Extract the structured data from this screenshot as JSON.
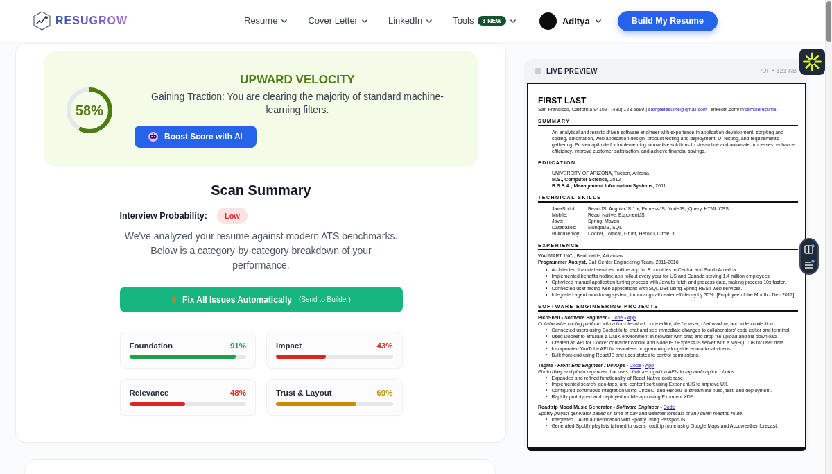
{
  "header": {
    "brand": "RESUGROW",
    "nav": [
      {
        "label": "Resume"
      },
      {
        "label": "Cover Letter"
      },
      {
        "label": "LinkedIn"
      },
      {
        "label": "Tools",
        "badge": "3 NEW"
      }
    ],
    "user": {
      "name": "Aditya"
    },
    "cta": "Build My Resume"
  },
  "score_card": {
    "score": "58%",
    "level": 0.58,
    "title": "UPWARD VELOCITY",
    "message": "Gaining Traction: You are clearing the majority of standard machine-learning filters.",
    "boost_button": "Boost Score with AI"
  },
  "scan_summary": {
    "title": "Scan Summary",
    "probability_label": "Interview Probability:",
    "probability_value": "Low",
    "description": "We've analyzed your resume against modern ATS benchmarks. Below is a category-by-category breakdown of your performance.",
    "fix_button": {
      "label": "Fix All Issues Automatically",
      "note": "(Send to Builder)"
    },
    "categories": [
      {
        "name": "Foundation",
        "value": "91%",
        "level": 0.91,
        "color": "#16a34a"
      },
      {
        "name": "Impact",
        "value": "43%",
        "level": 0.43,
        "color": "#dc2626"
      },
      {
        "name": "Relevance",
        "value": "48%",
        "level": 0.48,
        "color": "#dc2626"
      },
      {
        "name": "Trust & Layout",
        "value": "69%",
        "level": 0.69,
        "color": "#ca8a04"
      }
    ]
  },
  "preview": {
    "title": "LIVE PREVIEW",
    "file_info": "PDF • 121 KB",
    "resume": {
      "name": "FIRST LAST",
      "contact": [
        {
          "kind": "text",
          "text": "San Francisco, California 94109 | (480) 123-5689 | "
        },
        {
          "kind": "link",
          "text": "sampleresume@gmail.com"
        },
        {
          "kind": "text",
          "text": " | linkedin.com/in/"
        },
        {
          "kind": "link",
          "text": "sampleresume"
        }
      ],
      "sections": [
        {
          "kind": "paragraph",
          "heading": "SUMMARY",
          "text": "An analytical and results-driven software engineer with experience in application development, scripting and coding, automation, web application design, product testing and deployment, UI testing, and requirements gathering.  Proven aptitude for implementing innovative solutions to streamline and automate processes, enhance efficiency, improve customer satisfaction, and achieve financial savings."
        },
        {
          "kind": "lines",
          "heading": "EDUCATION",
          "lines": [
            "UNIVERSITY OF ARIZONA, Tucson, Arizona",
            "**M.S., Computer Science,** 2012",
            "**B.S.B.A., Management Information Systems,** 2011"
          ]
        },
        {
          "kind": "skills",
          "heading": "TECHNICAL SKILLS",
          "rows": [
            {
              "label": "JavaScript:",
              "value": "ReactJS, AngularJS 1.x, ExpressJS, NodeJS, jQuery, HTML/CSS"
            },
            {
              "label": "Mobile:",
              "value": "React Native, ExponentJS"
            },
            {
              "label": "Java:",
              "value": "Spring, Maven"
            },
            {
              "label": "Databases:",
              "value": "MongoDB, SQL"
            },
            {
              "label": "Build/Deploy:",
              "value": "Docker, Tomcat, Grunt, Heroku, CircleCI"
            }
          ]
        },
        {
          "kind": "jobs",
          "heading": "EXPERIENCE",
          "jobs": [
            {
              "employer": "WALMART, INC., Bentonville, Arkansas",
              "title": "**Programmer Analyst,** Call Center Engineering Team, 2011-2016",
              "bullets": [
                "Architected financial services hotline app for 8 countries in Central and South America.",
                "Implemented benefits hotline app rollout every year for US and Canada serving 1.4 million employees.",
                "Optimized manual application tuning process with Java to fetch and process data, making process 10x faster.",
                "Connected user-facing web applications with SQL DBs using Spring REST web services.",
                "Integrated agent monitoring system, improving call center efficiency by 30%. [Employee of the Month - Dec 2012]"
              ]
            }
          ]
        },
        {
          "kind": "projects",
          "heading": "SOFTWARE ENGINEERING PROJECTS",
          "projects": [
            {
              "heading": [
                {
                  "kind": "name",
                  "text": "PicoShell"
                },
                {
                  "kind": "sep",
                  "text": "•"
                },
                {
                  "kind": "role",
                  "text": "Software Engineer"
                },
                {
                  "kind": "sep",
                  "text": "•"
                },
                {
                  "kind": "link",
                  "text": "Code"
                },
                {
                  "kind": "sep",
                  "text": "•"
                },
                {
                  "kind": "link",
                  "text": "App"
                }
              ],
              "description": "Collaborative coding platform with a linux terminal, code editor, file browser, chat window, and video collection.",
              "bullets": [
                "Connected users using Socket.io to chat and see immediate changes to collaborators' code editor and terminal.",
                "Used Docker to emulate a UNIX environment in browser with drag and drop file upload and file download.",
                "Created an API for Docker container control and NodeJS / ExpressJS server with a MySQL DB for user data.",
                "Incorporated YouTube API for seamless programming alongside educational videos.",
                "Built front-end using ReactJS and uses states to control permissions."
              ]
            },
            {
              "heading": [
                {
                  "kind": "name",
                  "text": "TagMe"
                },
                {
                  "kind": "sep",
                  "text": "•"
                },
                {
                  "kind": "role",
                  "text": "Front-End Engineer / DevOps"
                },
                {
                  "kind": "sep",
                  "text": "•"
                },
                {
                  "kind": "link",
                  "text": "Code"
                },
                {
                  "kind": "sep",
                  "text": "•"
                },
                {
                  "kind": "link",
                  "text": "App"
                }
              ],
              "description": "Photo diary and photo organizer that uses photo-recognition APIs to tag and caption photos.",
              "bullets": [
                "Expanded and refined functionality of React Native codebase.",
                "Implemented search, geo-tags, and content sort using ExponentJS to improve UX.",
                "Configured continuous integration using CircleCI and Heroku to streamline build, test, and deployment.",
                "Rapidly prototyped and deployed mobile app using Exponent XDE."
              ]
            },
            {
              "heading": [
                {
                  "kind": "name",
                  "text": "Roadtrip Mood Music Generator"
                },
                {
                  "kind": "sep",
                  "text": "•"
                },
                {
                  "kind": "role",
                  "text": "Software Engineer"
                },
                {
                  "kind": "sep",
                  "text": "•"
                },
                {
                  "kind": "link",
                  "text": "Code"
                }
              ],
              "description": "Spotify playlist generator based on time of day and weather forecast of any given roadtrip route.",
              "bullets": [
                "Integrated OAuth authentication with Spotify using PassportJS.",
                "Generated Spotify playlists tailored to user's roadtrip route using Google Maps and Accuweather forecast."
              ]
            }
          ]
        }
      ]
    }
  }
}
